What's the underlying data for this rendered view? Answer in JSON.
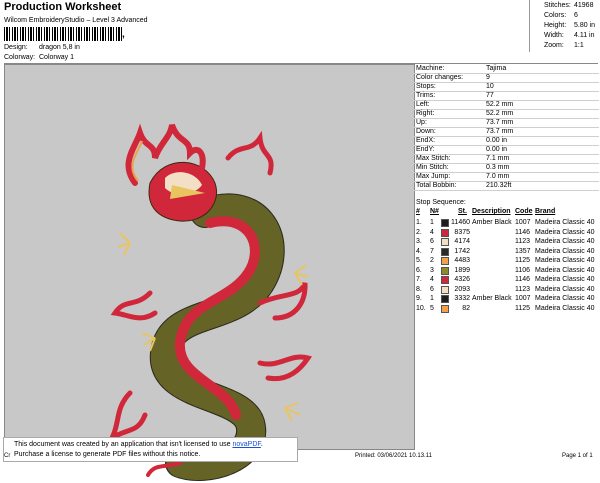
{
  "header": {
    "title": "Production Worksheet",
    "subtitle": "Wilcom EmbroideryStudio – Level 3 Advanced",
    "barcode_suffix": ",",
    "design_label": "Design:",
    "design_value": "dragon 5,8 in",
    "colorway_label": "Colorway:",
    "colorway_value": "Colorway 1"
  },
  "stats": [
    {
      "label": "Stitches:",
      "value": "41968"
    },
    {
      "label": "Colors:",
      "value": "6"
    },
    {
      "label": "Height:",
      "value": "5.80 in"
    },
    {
      "label": "Width:",
      "value": "4.11 in"
    },
    {
      "label": "Zoom:",
      "value": "1:1"
    }
  ],
  "properties": [
    {
      "label": "Machine:",
      "value": "Tajima"
    },
    {
      "label": "Color changes:",
      "value": "9"
    },
    {
      "label": "Stops:",
      "value": "10"
    },
    {
      "label": "Trims:",
      "value": "77"
    },
    {
      "label": "Left:",
      "value": "52.2 mm"
    },
    {
      "label": "Right:",
      "value": "52.2 mm"
    },
    {
      "label": "Up:",
      "value": "73.7 mm"
    },
    {
      "label": "Down:",
      "value": "73.7 mm"
    },
    {
      "label": "EndX:",
      "value": "0.00 in"
    },
    {
      "label": "EndY:",
      "value": "0.00 in"
    },
    {
      "label": "Max Stitch:",
      "value": "7.1 mm"
    },
    {
      "label": "Min Stitch:",
      "value": "0.3 mm"
    },
    {
      "label": "Max Jump:",
      "value": "7.0 mm"
    },
    {
      "label": "Total Bobbin:",
      "value": "210.32ft"
    }
  ],
  "stop_sequence": {
    "label": "Stop Sequence:",
    "columns": [
      "#",
      "N#",
      "St.",
      "Description",
      "Code",
      "Brand"
    ],
    "rows": [
      {
        "num": "1.",
        "n": "1",
        "color": "#1e1e1e",
        "st": "11460",
        "desc": "Amber Black",
        "code": "1007",
        "brand": "Madeira Classic 40"
      },
      {
        "num": "2.",
        "n": "4",
        "color": "#d0283a",
        "st": "8375",
        "desc": "",
        "code": "1146",
        "brand": "Madeira Classic 40"
      },
      {
        "num": "3.",
        "n": "6",
        "color": "#f3dfc6",
        "st": "4174",
        "desc": "",
        "code": "1123",
        "brand": "Madeira Classic 40"
      },
      {
        "num": "4.",
        "n": "7",
        "color": "#2a2a2a",
        "st": "1742",
        "desc": "",
        "code": "1357",
        "brand": "Madeira Classic 40"
      },
      {
        "num": "5.",
        "n": "2",
        "color": "#f0a14a",
        "st": "4483",
        "desc": "",
        "code": "1125",
        "brand": "Madeira Classic 40"
      },
      {
        "num": "6.",
        "n": "3",
        "color": "#8e8a2c",
        "st": "1899",
        "desc": "",
        "code": "1106",
        "brand": "Madeira Classic 40"
      },
      {
        "num": "7.",
        "n": "4",
        "color": "#d0283a",
        "st": "4326",
        "desc": "",
        "code": "1146",
        "brand": "Madeira Classic 40"
      },
      {
        "num": "8.",
        "n": "6",
        "color": "#f3dfc6",
        "st": "2093",
        "desc": "",
        "code": "1123",
        "brand": "Madeira Classic 40"
      },
      {
        "num": "9.",
        "n": "1",
        "color": "#1e1e1e",
        "st": "3332",
        "desc": "Amber Black",
        "code": "1007",
        "brand": "Madeira Classic 40"
      },
      {
        "num": "10.",
        "n": "5",
        "color": "#f0a14a",
        "st": "82",
        "desc": "",
        "code": "1125",
        "brand": "Madeira Classic 40"
      }
    ]
  },
  "notice": {
    "line1_prefix": "This document was created by an application that isn't licensed to use ",
    "link": "novaPDF",
    "line1_suffix": ".",
    "line2": "Purchase a license to generate PDF files without this notice."
  },
  "footer": {
    "cr": "Cr",
    "printed": "Printed: 03/06/2021 10.13.11",
    "page": "Page 1 of 1"
  }
}
